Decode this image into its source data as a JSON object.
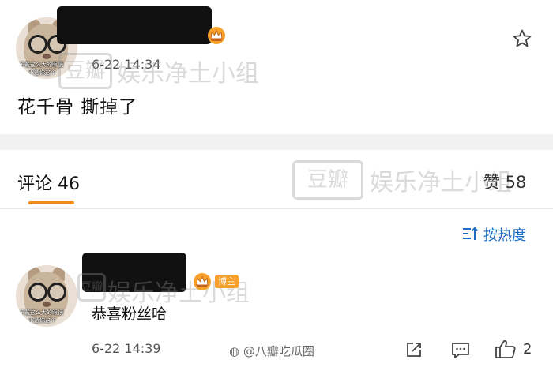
{
  "post": {
    "time": "6-22 14:34",
    "text": "花千骨 撕掉了",
    "avatar_caption_1": "子戴这么大的眼镜",
    "avatar_caption_2": "不透你这个"
  },
  "comments_header": {
    "tab_label": "评论 46",
    "likes_label": "赞 58",
    "sort_label": "按热度"
  },
  "comment": {
    "badge": "博主",
    "text": "恭喜粉丝哈",
    "time": "6-22 14:39",
    "like_count": "2",
    "avatar_caption_1": "子戴这么大的眼镜",
    "avatar_caption_2": "不透你这个"
  },
  "watermarks": {
    "box_text": "豆瓣",
    "group_text": "娱乐净土小组",
    "footer": "@八瓣吃瓜圈"
  },
  "colors": {
    "accent": "#f08c1e",
    "link": "#1a6cc4",
    "badge": "#f7a12a",
    "band": "#f1f1f1"
  },
  "icons": [
    "star-icon",
    "crown-icon",
    "sort-icon",
    "share-icon",
    "comment-icon",
    "thumbs-up-icon"
  ]
}
